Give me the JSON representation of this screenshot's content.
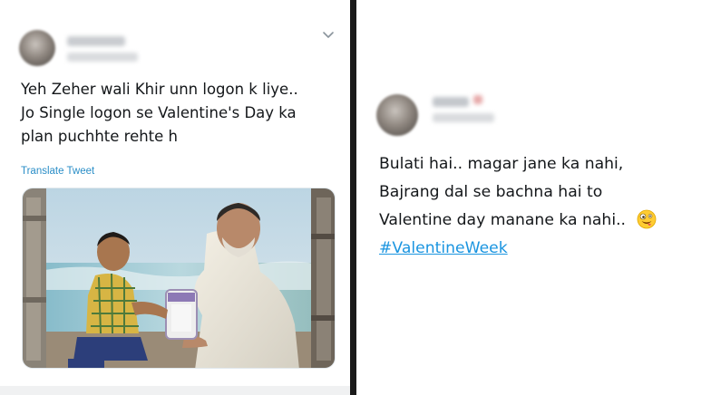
{
  "left_tweet": {
    "text_lines": [
      "Yeh Zeher wali Khir unn logon k liye..",
      "Jo Single logon se Valentine's Day ka",
      "plan puchhte rehte h"
    ],
    "translate_label": "Translate Tweet",
    "menu_icon": "chevron-down-icon",
    "media_description_icon": "photo"
  },
  "right_tweet": {
    "text_lines": [
      "Bulati hai.. magar jane ka nahi,",
      "Bajrang dal se bachna hai to",
      "Valentine day manane ka nahi.."
    ],
    "hashtag": "#ValentineWeek",
    "emoji_icon": "zany-face-emoji"
  },
  "colors": {
    "text": "#14171a",
    "link": "#2a8ec7",
    "hashtag": "#1b95e0",
    "divider": "#1a1a1a"
  }
}
